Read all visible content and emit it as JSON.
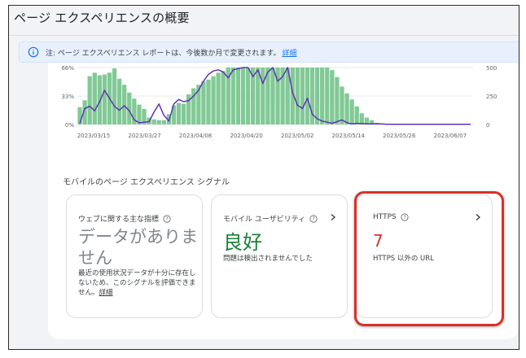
{
  "page": {
    "title": "ページ エクスペリエンスの概要"
  },
  "notice": {
    "text": "注: ページ エクスペリエンス レポートは、今後数か月で変更されます。",
    "link": "詳細"
  },
  "chart_data": {
    "type": "bar+line",
    "x_ticks": [
      "2023/03/15",
      "2023/03/27",
      "2023/04/08",
      "2023/04/20",
      "2023/05/02",
      "2023/05/14",
      "2023/05/26",
      "2023/06/07"
    ],
    "y_left_ticks": [
      "66%",
      "33%",
      "0%"
    ],
    "y_right_ticks": [
      "500",
      "250",
      "0"
    ],
    "ylim_left": [
      0,
      0.66
    ],
    "ylim_right": [
      0,
      500
    ],
    "bar_color": "#81c995",
    "line_color": "#5e35b1",
    "bars": [
      0.2,
      0.28,
      0.56,
      0.6,
      0.57,
      0.58,
      0.6,
      0.65,
      0.53,
      0.46,
      0.37,
      0.3,
      0.23,
      0.18,
      0.08,
      0.06,
      0.05,
      0.05,
      0.12,
      0.22,
      0.25,
      0.24,
      0.35,
      0.42,
      0.46,
      0.5,
      0.52,
      0.56,
      0.6,
      0.62,
      0.66,
      0.66,
      0.66,
      0.66,
      0.66,
      0.66,
      0.66,
      0.66,
      0.66,
      0.66,
      0.66,
      0.66,
      0.66,
      0.66,
      0.66,
      0.66,
      0.66,
      0.66,
      0.66,
      0.66,
      0.66,
      0.63,
      0.55,
      0.44,
      0.36,
      0.29,
      0.21,
      0.13,
      0.08,
      0.05,
      0.02,
      0.01,
      0.01,
      0.01,
      0,
      0,
      0,
      0,
      0,
      0,
      0,
      0,
      0,
      0,
      0,
      0,
      0,
      0,
      0,
      0
    ],
    "line": [
      10,
      140,
      160,
      120,
      200,
      300,
      230,
      160,
      125,
      165,
      120,
      40,
      15,
      20,
      25,
      110,
      180,
      80,
      30,
      180,
      220,
      200,
      210,
      250,
      300,
      380,
      440,
      470,
      480,
      460,
      410,
      480,
      490,
      500,
      500,
      420,
      480,
      360,
      460,
      500,
      380,
      420,
      500,
      280,
      170,
      140,
      230,
      90,
      50,
      30,
      20,
      10,
      25,
      40,
      15,
      5,
      10,
      8,
      5,
      5,
      5,
      5,
      2,
      2,
      2,
      2,
      2,
      2,
      2,
      2,
      2,
      2,
      2,
      2,
      2,
      2,
      2,
      2,
      2,
      2
    ]
  },
  "section": {
    "heading": "モバイルのページ エクスペリエンス シグナル"
  },
  "cards": {
    "vitals": {
      "title": "ウェブに関する主な指標",
      "value": "データがありません",
      "desc": "最近の使用状況データが十分に存在しないため、このシグナルを評価できません。",
      "link": "詳細"
    },
    "mobile": {
      "title": "モバイル ユーザビリティ",
      "value": "良好",
      "desc": "問題は検出されませんでした",
      "value_color": "#188038"
    },
    "https": {
      "title": "HTTPS",
      "value": "7",
      "desc": "HTTPS 以外の URL",
      "value_color": "#d93025"
    }
  },
  "icons": {
    "info": "info-icon",
    "help": "help-circle-icon",
    "chevron": "chevron-right-icon"
  },
  "highlight_color": "#d93025"
}
